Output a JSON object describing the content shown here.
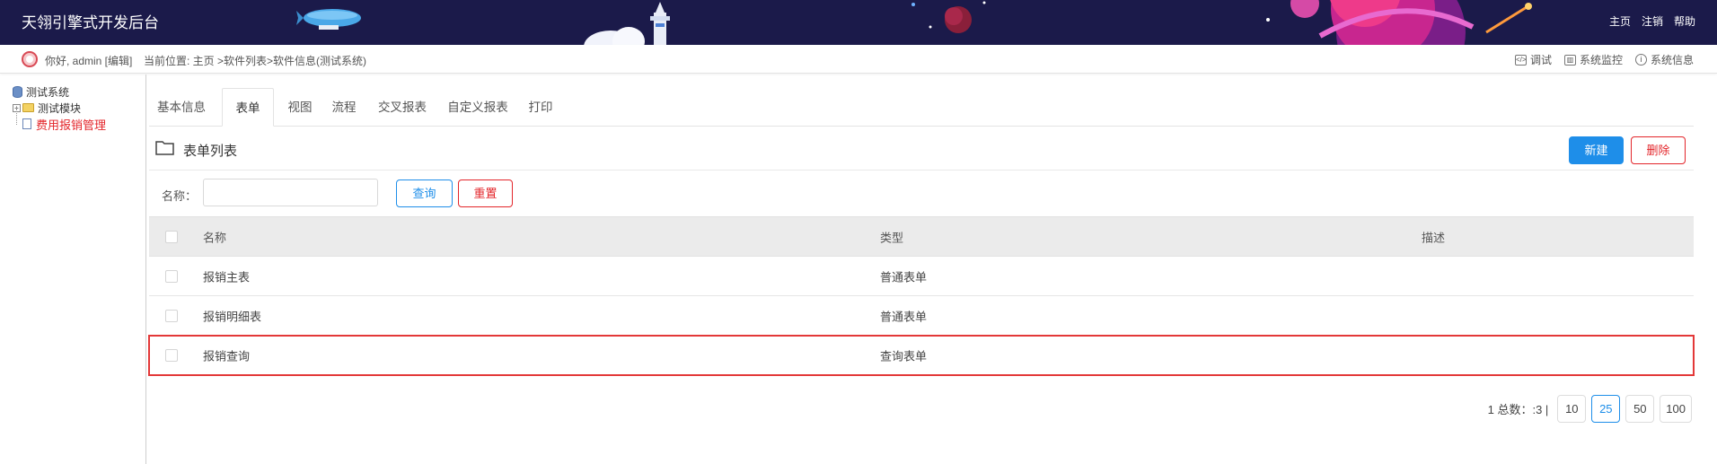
{
  "header": {
    "app_title": "天翎引擎式开发后台",
    "nav": [
      "主页",
      "注销",
      "帮助"
    ]
  },
  "subbar": {
    "greeting": "你好, admin [编辑]",
    "breadcrumb": "当前位置: 主页 >软件列表>软件信息(测试系统)",
    "tools": [
      {
        "label": "调试",
        "icon": "debug-icon"
      },
      {
        "label": "系统监控",
        "icon": "monitor-icon"
      },
      {
        "label": "系统信息",
        "icon": "info-icon"
      }
    ]
  },
  "tree": {
    "root": "测试系统",
    "module": "测试模块",
    "active_item": "费用报销管理"
  },
  "tabs": [
    "基本信息",
    "表单",
    "视图",
    "流程",
    "交叉报表",
    "自定义报表",
    "打印"
  ],
  "active_tab": "表单",
  "section": {
    "title": "表单列表",
    "new_label": "新建",
    "delete_label": "删除"
  },
  "filter": {
    "name_label": "名称：",
    "name_value": "",
    "query_label": "查询",
    "reset_label": "重置"
  },
  "table": {
    "headers": [
      "名称",
      "类型",
      "描述"
    ],
    "rows": [
      {
        "name": "报销主表",
        "type": "普通表单",
        "desc": ""
      },
      {
        "name": "报销明细表",
        "type": "普通表单",
        "desc": ""
      },
      {
        "name": "报销查询",
        "type": "查询表单",
        "desc": ""
      }
    ],
    "highlighted_row": 2
  },
  "pagination": {
    "info": "1  总数：:3  |",
    "page_sizes": [
      "10",
      "25",
      "50",
      "100"
    ],
    "active_size": "25"
  },
  "colors": {
    "header_bg": "#1b1a4a",
    "primary": "#1e8ee9",
    "danger": "#e3252a"
  }
}
